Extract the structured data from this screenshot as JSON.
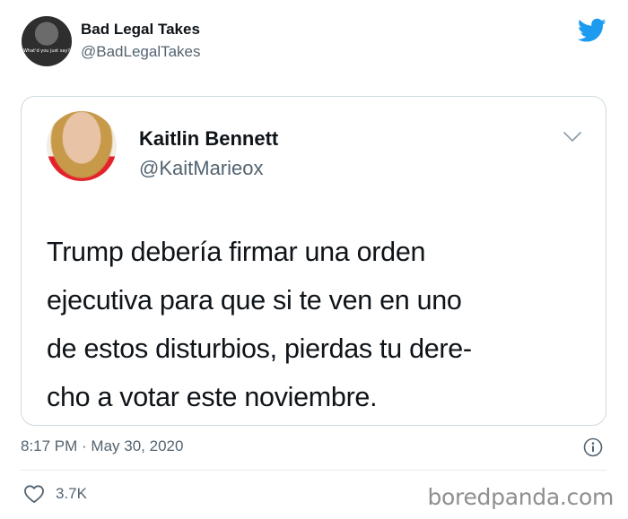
{
  "outer_tweet": {
    "display_name": "Bad Legal Takes",
    "handle": "@BadLegalTakes",
    "avatar_caption": "What'd you just say?"
  },
  "quoted_tweet": {
    "display_name": "Kaitlin Bennett",
    "handle": "@KaitMarieox",
    "text_lines": [
      "Trump debería firmar una orden",
      "ejecutiva para que si te ven en uno",
      "de estos disturbios, pierdas tu dere-",
      "cho a votar este noviembre."
    ]
  },
  "meta": {
    "timestamp": "8:17 PM · May 30, 2020",
    "likes": "3.7K"
  },
  "watermark": "boredpanda.com",
  "colors": {
    "twitter_blue": "#1d9bf0",
    "secondary_text": "#536471",
    "border": "#cfd9de"
  },
  "icons": [
    "twitter-bird-icon",
    "chevron-down-icon",
    "info-icon",
    "heart-icon"
  ]
}
